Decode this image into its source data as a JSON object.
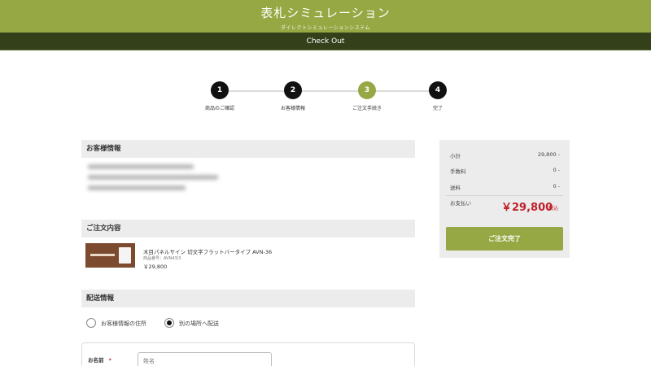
{
  "header": {
    "title": "表札シミュレーション",
    "subtitle": "ダイレクトシミュレーションシステム"
  },
  "subbar": {
    "label": "Check Out"
  },
  "steps": [
    {
      "number": "1",
      "label": "商品のご確認"
    },
    {
      "number": "2",
      "label": "お客様情報"
    },
    {
      "number": "3",
      "label": "ご注文手続き"
    },
    {
      "number": "4",
      "label": "完了"
    }
  ],
  "sections": {
    "customer": "お客様情報",
    "order": "ご注文内容",
    "shipping": "配送情報"
  },
  "order": {
    "product_name": "木目パネルサイン 切文字フラットバータイプ AVN-36",
    "product_code": "商品番号：AVN43/3",
    "product_price": "￥29,800"
  },
  "shipping": {
    "option_same": "お客様情報の住所",
    "option_other": "別の場所へ配送",
    "name_label": "お名前",
    "required_mark": "*",
    "name_placeholder": "姓名"
  },
  "summary": {
    "subtotal_label": "小計",
    "subtotal_value": "29,800 -",
    "fee_label": "手数料",
    "fee_value": "0 -",
    "shipping_label": "送料",
    "shipping_value": "0 -",
    "total_label": "お支払い",
    "total_value": "￥29,800",
    "tax_note": "税込",
    "complete_button": "ご注文完了"
  },
  "colors": {
    "accent": "#96a843",
    "subbar": "#33401a",
    "price_red": "#c0202a"
  }
}
